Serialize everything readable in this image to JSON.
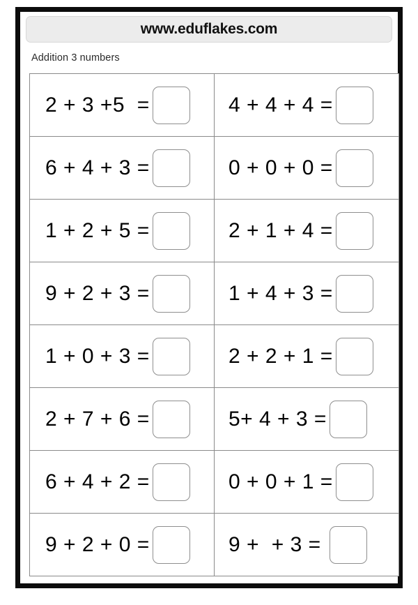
{
  "header": {
    "site_title": "www.eduflakes.com"
  },
  "subtitle": "Addition 3 numbers",
  "worksheet": {
    "rows": [
      {
        "left": {
          "expression": "2 + 3 +5  =",
          "answer": ""
        },
        "right": {
          "expression": "4 + 4 + 4 =",
          "answer": ""
        }
      },
      {
        "left": {
          "expression": "6 + 4 + 3 =",
          "answer": ""
        },
        "right": {
          "expression": "0 + 0 + 0 =",
          "answer": ""
        }
      },
      {
        "left": {
          "expression": "1 + 2 + 5 =",
          "answer": ""
        },
        "right": {
          "expression": "2 + 1 + 4 =",
          "answer": ""
        }
      },
      {
        "left": {
          "expression": "9 + 2 + 3 =",
          "answer": ""
        },
        "right": {
          "expression": "1 + 4 + 3 =",
          "answer": ""
        }
      },
      {
        "left": {
          "expression": "1 + 0 + 3 =",
          "answer": ""
        },
        "right": {
          "expression": "2 + 2 + 1 =",
          "answer": ""
        }
      },
      {
        "left": {
          "expression": "2 + 7 + 6 =",
          "answer": ""
        },
        "right": {
          "expression": "5+ 4 + 3 =",
          "answer": ""
        }
      },
      {
        "left": {
          "expression": "6 + 4 + 2 =",
          "answer": ""
        },
        "right": {
          "expression": "0 + 0 + 1 =",
          "answer": ""
        }
      },
      {
        "left": {
          "expression": "9 + 2 + 0 =",
          "answer": ""
        },
        "right": {
          "expression": "9 +  + 3 =",
          "answer": ""
        }
      }
    ]
  },
  "colors": {
    "frame": "#0c0c0c",
    "banner_bg": "#ececec",
    "grid_line": "#8a8a8a",
    "answer_box_border": "#8e8e8e",
    "text": "#000000"
  }
}
